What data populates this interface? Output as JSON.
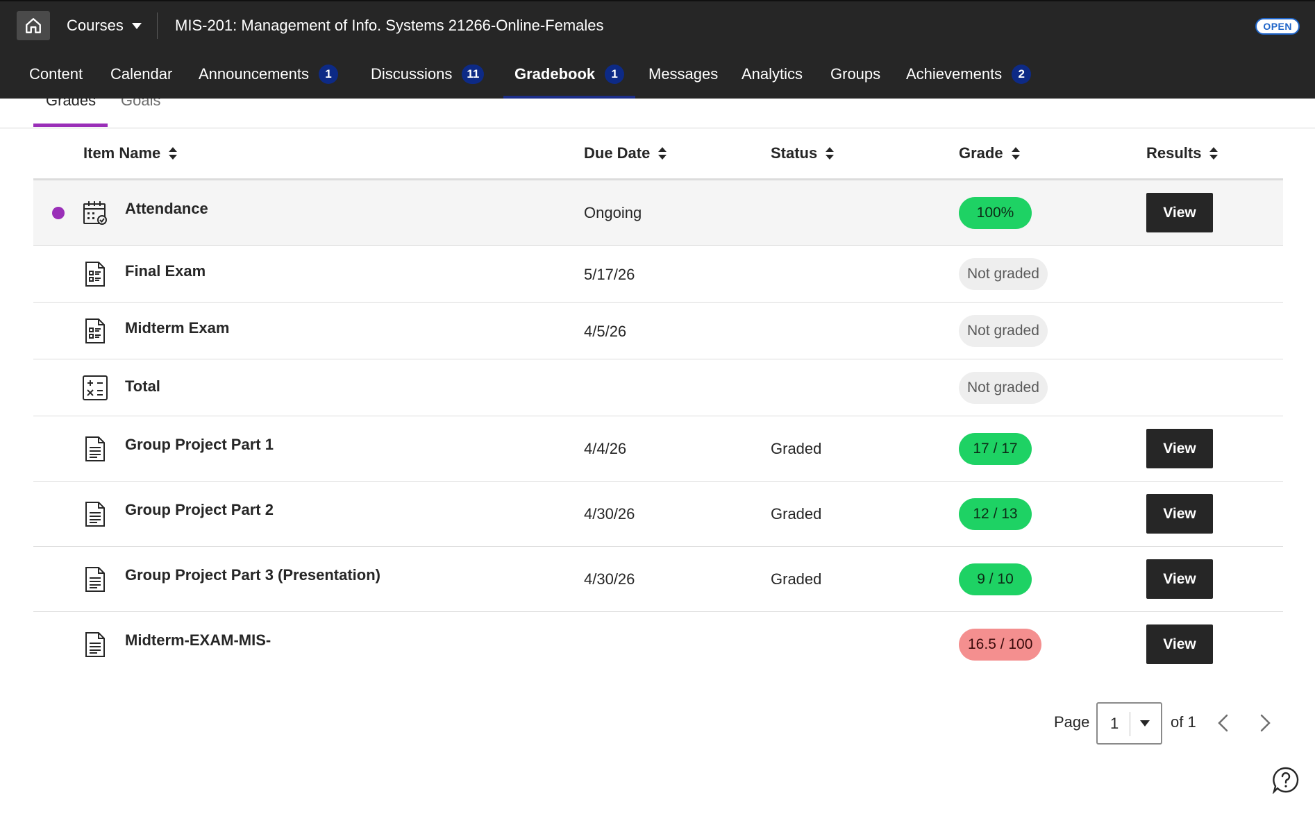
{
  "topbar": {
    "home_icon": "home-icon",
    "courses_label": "Courses",
    "course_title": "MIS-201: Management of Info. Systems 21266-Online-Females",
    "open_badge": "OPEN"
  },
  "nav": {
    "tabs": [
      {
        "label": "Content",
        "badge": ""
      },
      {
        "label": "Calendar",
        "badge": ""
      },
      {
        "label": "Announcements",
        "badge": "1"
      },
      {
        "label": "Discussions",
        "badge": "11"
      },
      {
        "label": "Gradebook",
        "badge": "1",
        "active": true
      },
      {
        "label": "Messages",
        "badge": ""
      },
      {
        "label": "Analytics",
        "badge": ""
      },
      {
        "label": "Groups",
        "badge": ""
      },
      {
        "label": "Achievements",
        "badge": "2"
      }
    ]
  },
  "subtabs": {
    "grades": "Grades",
    "goals": "Goals"
  },
  "table": {
    "headers": {
      "item_name": "Item Name",
      "due_date": "Due Date",
      "status": "Status",
      "grade": "Grade",
      "results": "Results"
    },
    "rows": [
      {
        "icon": "attendance-calendar-icon",
        "name": "Attendance",
        "due": "Ongoing",
        "status": "",
        "grade": "100%",
        "grade_style": "green",
        "view": "View",
        "new_dot": true
      },
      {
        "icon": "test-document-icon",
        "name": "Final Exam",
        "due": "5/17/26",
        "status": "",
        "grade": "Not graded",
        "grade_style": "grey",
        "view": ""
      },
      {
        "icon": "test-document-icon",
        "name": "Midterm Exam",
        "due": "4/5/26",
        "status": "",
        "grade": "Not graded",
        "grade_style": "grey",
        "view": ""
      },
      {
        "icon": "calculator-icon",
        "name": "Total",
        "due": "",
        "status": "",
        "grade": "Not graded",
        "grade_style": "grey",
        "view": ""
      },
      {
        "icon": "assignment-document-icon",
        "name": "Group Project Part 1",
        "due": "4/4/26",
        "status": "Graded",
        "grade": "17 / 17",
        "grade_style": "green",
        "view": "View"
      },
      {
        "icon": "assignment-document-icon",
        "name": "Group Project Part 2",
        "due": "4/30/26",
        "status": "Graded",
        "grade": "12 / 13",
        "grade_style": "green",
        "view": "View"
      },
      {
        "icon": "assignment-document-icon",
        "name": "Group Project Part 3 (Presentation)",
        "due": "4/30/26",
        "status": "Graded",
        "grade": "9 / 10",
        "grade_style": "green",
        "view": "View"
      },
      {
        "icon": "assignment-document-icon",
        "name": "Midterm-EXAM-MIS-",
        "due": "",
        "status": "",
        "grade": "16.5 / 100",
        "grade_style": "red",
        "view": "View"
      }
    ]
  },
  "pagination": {
    "page_label": "Page",
    "current_page": "1",
    "of_label": "of 1"
  },
  "colors": {
    "topbar_bg": "#262626",
    "badge_navy": "#0d2a86",
    "accent_purple": "#9a2fb8",
    "grade_green": "#1ed264",
    "grade_red": "#f48f8f",
    "open_blue": "#1e64c8"
  }
}
